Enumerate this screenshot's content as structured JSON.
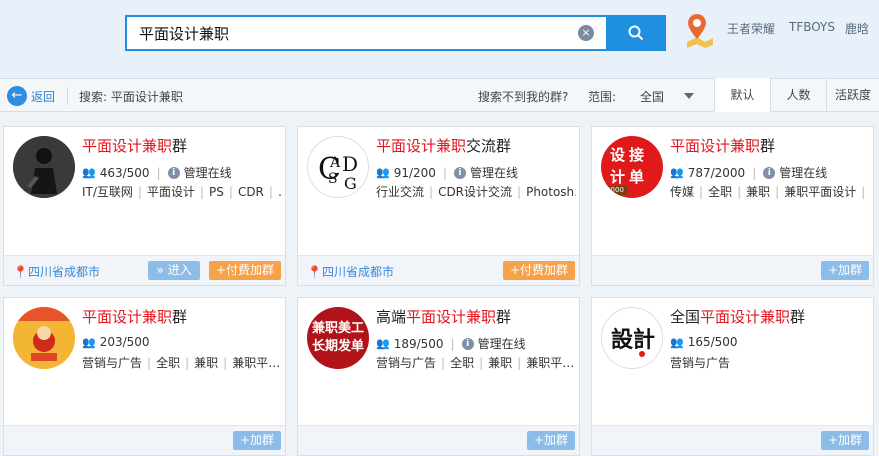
{
  "search": {
    "value": "平面设计兼职",
    "clear": "×"
  },
  "hot_links": [
    "王者荣耀",
    "TFBOYS",
    "鹿晗"
  ],
  "filter": {
    "back": "返回",
    "back_arrow": "←",
    "query_label": "搜索: 平面设计兼职",
    "not_found": "搜索不到我的群?",
    "range_label": "范围:",
    "range_value": "全国",
    "sort_tabs": [
      "默认",
      "人数",
      "活跃度"
    ]
  },
  "cards": [
    {
      "title_pre": "",
      "title_hl": "平面设计兼职",
      "title_post": "群",
      "members": "463/500",
      "admin": "管理在线",
      "tags": [
        "IT/互联网",
        "平面设计",
        "PS",
        "CDR",
        "…"
      ],
      "location": "四川省成都市",
      "enter": "» 进入",
      "pay_join": "+付费加群"
    },
    {
      "title_pre": "",
      "title_hl": "平面设计兼职",
      "title_post": "交流群",
      "members": "91/200",
      "admin": "管理在线",
      "tags": [
        "行业交流",
        "CDR设计交流",
        "Photosh…"
      ],
      "location": "四川省成都市",
      "pay_join": "+付费加群"
    },
    {
      "title_pre": "",
      "title_hl": "平面设计兼职",
      "title_post": "群",
      "members": "787/2000",
      "admin": "管理在线",
      "tags": [
        "传媒",
        "全职",
        "兼职",
        "兼职平面设计",
        "…"
      ],
      "join": "+加群",
      "avatar_text": [
        "设",
        "接",
        "计",
        "单"
      ],
      "avatar_badge": "2000"
    },
    {
      "title_pre": "",
      "title_hl": "平面设计兼职",
      "title_post": "群",
      "members": "203/500",
      "tags": [
        "营销与广告",
        "全职",
        "兼职",
        "兼职平…"
      ],
      "join": "+加群"
    },
    {
      "title_pre": "高端",
      "title_hl": "平面设计兼职",
      "title_post": "群",
      "members": "189/500",
      "admin": "管理在线",
      "tags": [
        "营销与广告",
        "全职",
        "兼职",
        "兼职平…"
      ],
      "join": "+加群",
      "avatar_text": [
        "兼职美工",
        "长期发单"
      ]
    },
    {
      "title_pre": "全国",
      "title_hl": "平面设计兼职",
      "title_post": "群",
      "members": "165/500",
      "tags": [
        "营销与广告"
      ],
      "join": "+加群",
      "avatar_text": "設計"
    }
  ],
  "colors": {
    "accent": "#1f8fe0",
    "highlight": "#e4161e",
    "orange": "#f6a24a"
  }
}
